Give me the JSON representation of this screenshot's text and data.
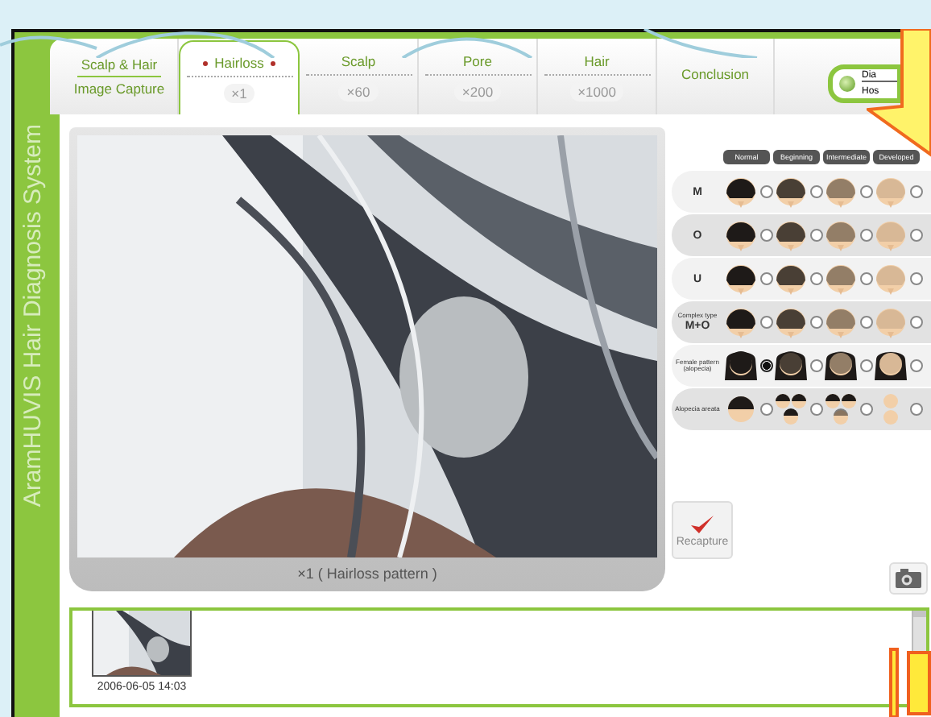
{
  "app_title": "AramHUVIS Hair Diagnosis System",
  "tabs": [
    {
      "label": "Scalp & Hair",
      "label_2": "Image Capture",
      "selected": false
    },
    {
      "label": "Hairloss",
      "zoom": "×1",
      "selected": true
    },
    {
      "label": "Scalp",
      "zoom": "×60",
      "selected": false
    },
    {
      "label": "Pore",
      "zoom": "×200",
      "selected": false
    },
    {
      "label": "Hair",
      "zoom": "×1000",
      "selected": false
    },
    {
      "label": "Conclusion",
      "selected": false
    }
  ],
  "corner_button": {
    "line_1": "Dia",
    "line_2": "Hos"
  },
  "viewer": {
    "kind": "picture",
    "caption": "×1 ( Hairloss pattern )"
  },
  "pattern_chart": {
    "stages": [
      "Normal",
      "Beginning",
      "Intermediate",
      "Developed"
    ],
    "rows": [
      {
        "label": "M",
        "kind": "male",
        "options": [
          {
            "selected": false
          },
          {
            "selected": false
          },
          {
            "selected": false
          },
          {
            "selected": false
          }
        ]
      },
      {
        "label": "O",
        "kind": "male",
        "options": [
          {
            "selected": false
          },
          {
            "selected": false
          },
          {
            "selected": false
          },
          {
            "selected": false
          }
        ]
      },
      {
        "label": "U",
        "kind": "male",
        "options": [
          {
            "selected": false
          },
          {
            "selected": false
          },
          {
            "selected": false
          },
          {
            "selected": false
          }
        ]
      },
      {
        "label": "Complex type",
        "label_2": "M+O",
        "kind": "male",
        "options": [
          {
            "selected": false
          },
          {
            "selected": false
          },
          {
            "selected": false
          },
          {
            "selected": false
          }
        ]
      },
      {
        "label": "Female pattern (alopecia)",
        "kind": "female",
        "options": [
          {
            "selected": true
          },
          {
            "selected": false
          },
          {
            "selected": false
          },
          {
            "selected": false
          }
        ]
      },
      {
        "label": "Alopecia areata",
        "kind": "areata",
        "options": [
          {
            "selected": false
          },
          {
            "selected": false
          },
          {
            "selected": false
          },
          {
            "selected": false
          }
        ]
      }
    ]
  },
  "recapture_button": {
    "label": "Recapture"
  },
  "thumbnails": [
    {
      "kind": "picture",
      "timestamp": "2006-06-05 14:03"
    }
  ]
}
